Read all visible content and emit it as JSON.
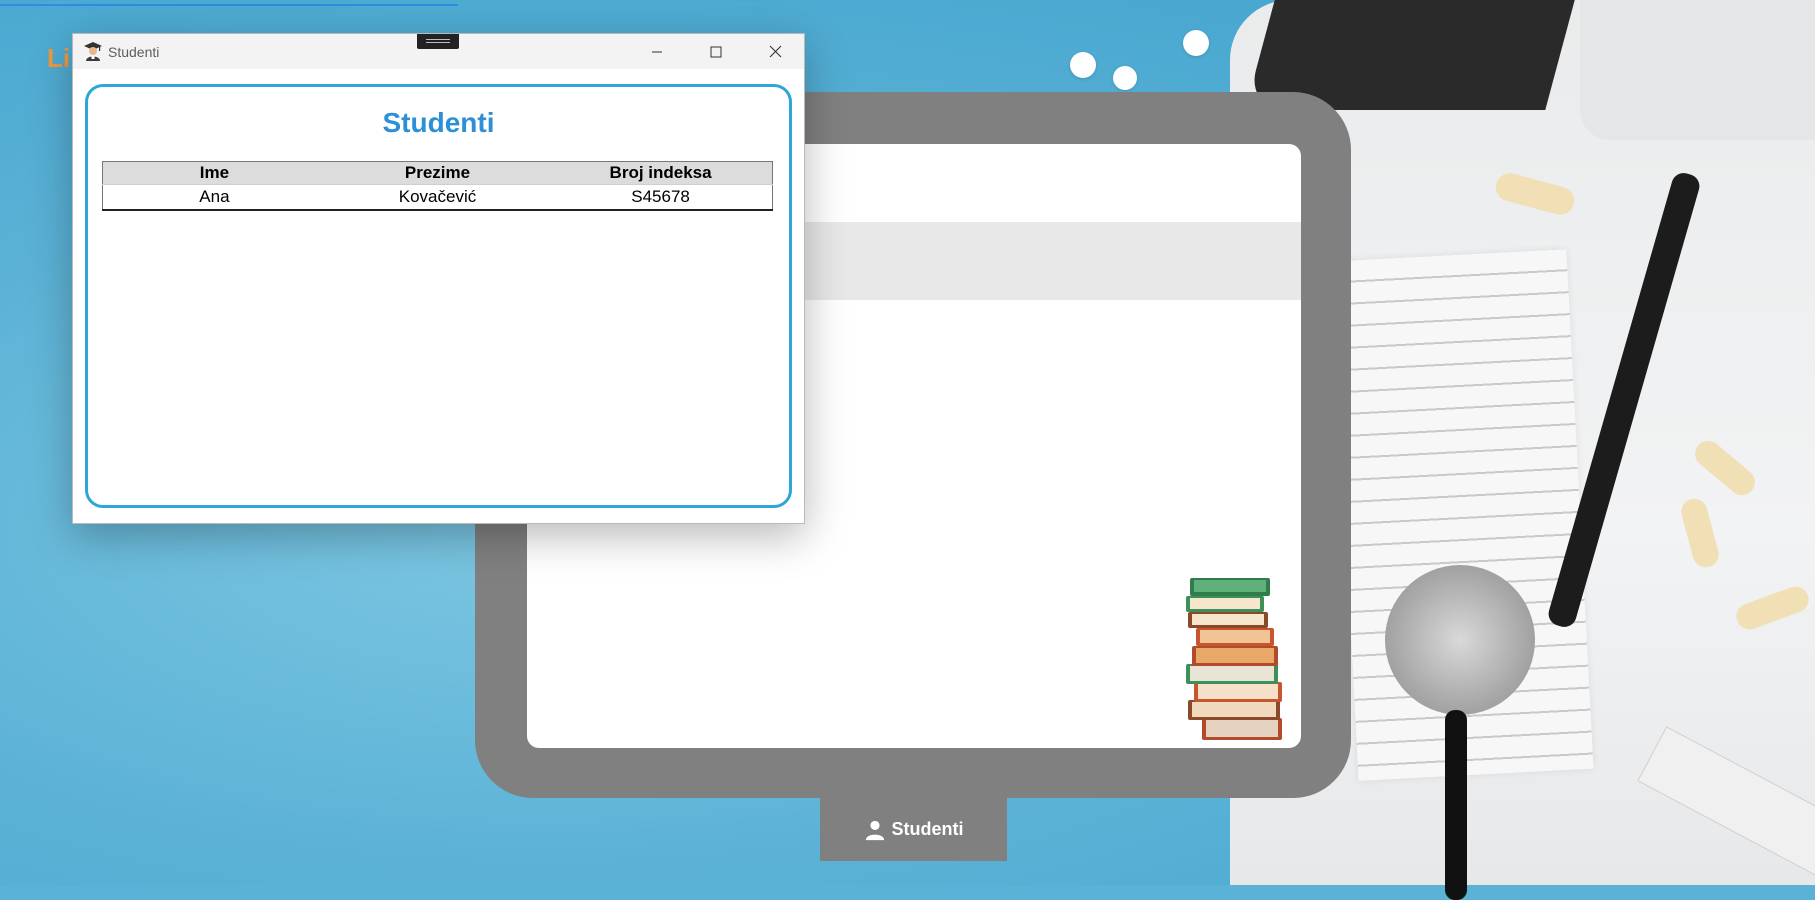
{
  "window": {
    "title": "Studenti",
    "panel_title": "Studenti",
    "icon": "student-graduate-icon"
  },
  "table": {
    "columns": [
      "Ime",
      "Prezime",
      "Broj indeksa"
    ],
    "rows": [
      [
        "Ana",
        "Kovačević",
        "S45678"
      ]
    ]
  },
  "background_app": {
    "peek_title": "Li",
    "students_button_label": "Studenti",
    "students_button_icon": "person-icon"
  },
  "colors": {
    "accent_title": "#2d8fd6",
    "panel_border": "#2ea6d6",
    "tablet_frame": "#808080",
    "peek_title": "#f29a3a"
  }
}
